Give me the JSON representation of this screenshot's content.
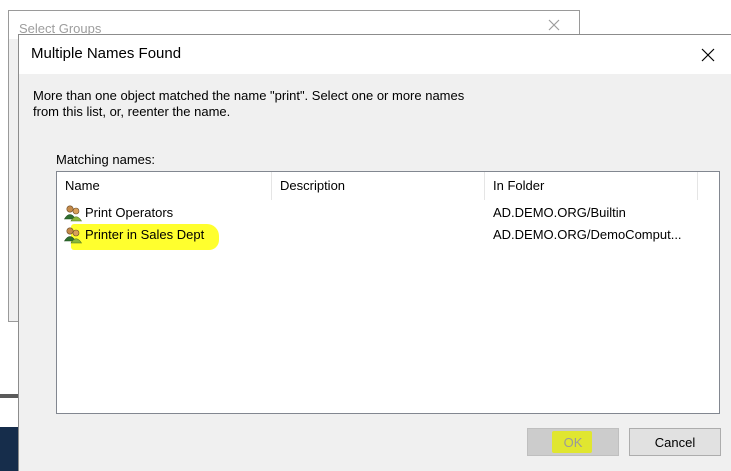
{
  "background_window": {
    "title": "Select Groups"
  },
  "dialog": {
    "title": "Multiple Names Found",
    "message_line1": "More than one object matched the name \"print\". Select one or more names",
    "message_line2": "from this list, or, reenter the name.",
    "matching_label": "Matching names:"
  },
  "list": {
    "columns": [
      "Name",
      "Description",
      "In Folder"
    ],
    "rows": [
      {
        "name": "Print Operators",
        "description": "",
        "folder": "AD.DEMO.ORG/Builtin",
        "icon": "group-icon"
      },
      {
        "name": "Printer in Sales Dept",
        "description": "",
        "folder": "AD.DEMO.ORG/DemoComput...",
        "icon": "group-icon",
        "highlighted": true
      }
    ]
  },
  "buttons": {
    "ok": "OK",
    "cancel": "Cancel"
  },
  "colors": {
    "highlight": "#ffff2e",
    "dialog_bg": "#f0f0f0"
  }
}
